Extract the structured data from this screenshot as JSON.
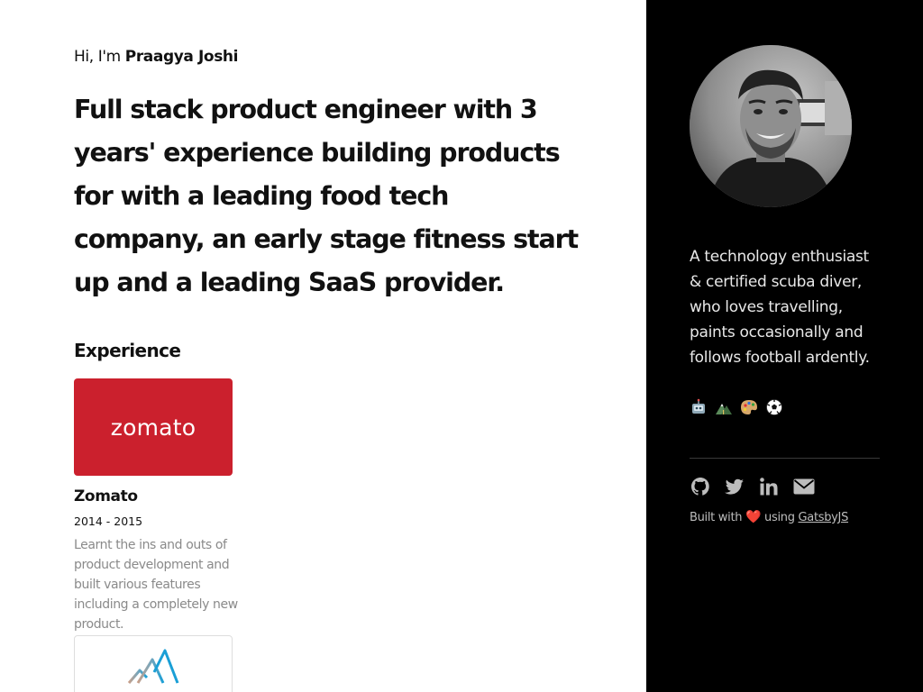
{
  "intro": {
    "greeting_prefix": "Hi, I'm ",
    "name": "Praagya Joshi",
    "headline": "Full stack product engineer with 3 years' experience building products for with a leading food tech company, an early stage fitness start up and a leading SaaS provider."
  },
  "experience": {
    "heading": "Experience",
    "items": [
      {
        "logo_text": "zomato",
        "logo_color": "#cb202d",
        "company": "Zomato",
        "dates": "2014 - 2015",
        "description": "Learnt the ins and outs of product development and built various features including a completely new product."
      },
      {
        "logo_icon": "mountain-logo-icon"
      }
    ]
  },
  "sidebar": {
    "background": "#000000",
    "avatar_icon": "profile-photo",
    "bio": "A technology enthusiast & certified scuba diver, who loves travelling, paints occasionally and follows football ardently.",
    "hobbies": [
      "robot-icon",
      "mountain-icon",
      "palette-icon",
      "football-icon"
    ],
    "social": [
      "github-icon",
      "twitter-icon",
      "linkedin-icon",
      "email-icon"
    ],
    "built_prefix": "Built with",
    "built_heart": "❤️",
    "built_middle": "using",
    "built_link": "GatsbyJS"
  }
}
